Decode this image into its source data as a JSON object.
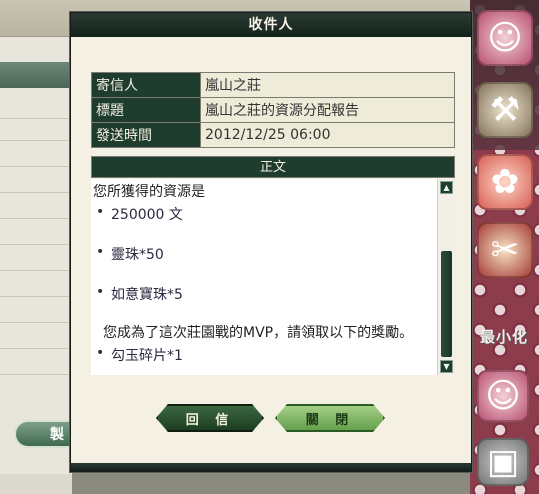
{
  "dialog": {
    "title": "收件人",
    "fields": [
      {
        "label": "寄信人",
        "value": "嵐山之莊"
      },
      {
        "label": "標題",
        "value": "嵐山之莊的資源分配報告"
      },
      {
        "label": "發送時間",
        "value": "2012/12/25 06:00"
      }
    ],
    "body_header": "正文",
    "body": {
      "intro": "您所獲得的資源是",
      "resources": [
        "250000 文",
        "靈珠*50",
        "如意寶珠*5"
      ],
      "mvp_line": "您成為了這次莊園戰的MVP，請領取以下的獎勵。",
      "rewards": [
        "勾玉碎片*1"
      ]
    },
    "buttons": {
      "reply": "回 信",
      "close": "關 閉"
    }
  },
  "background": {
    "left_button": "製",
    "minimize_label": "最小化"
  },
  "icons": {
    "side": [
      "character-portrait-icon",
      "hammer-icon",
      "gift-bag-icon",
      "crafting-icon",
      "character-portrait-icon",
      "chest-icon"
    ],
    "scroll_up": "arrow-up-icon",
    "scroll_down": "arrow-down-icon"
  },
  "colors": {
    "title_bar": "#1a2b22",
    "label_bg": "#1f3d2e",
    "dialog_bg": "#f4f1e4",
    "close_button": "#8cc46c",
    "reply_button": "#2f5a35"
  }
}
